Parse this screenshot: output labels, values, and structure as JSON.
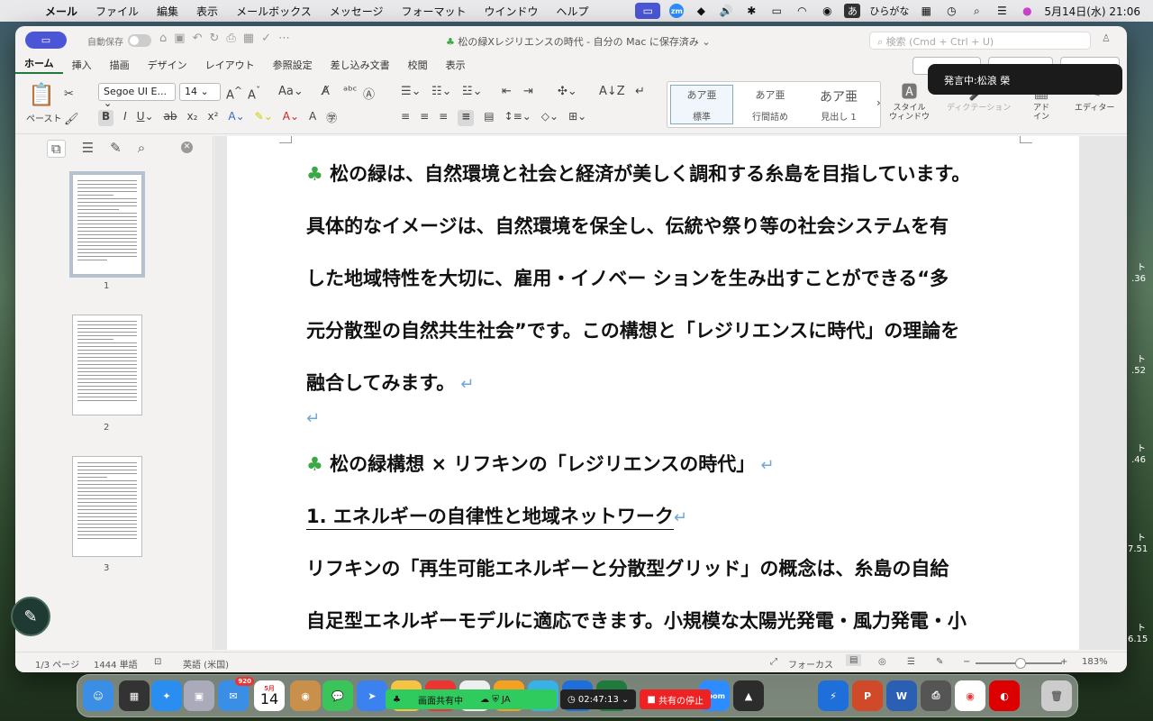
{
  "menubar": {
    "apple": "",
    "app": "メール",
    "items": [
      "ファイル",
      "編集",
      "表示",
      "メールボックス",
      "メッセージ",
      "フォーマット",
      "ウインドウ",
      "ヘルプ"
    ],
    "ime": "あ",
    "ime_label": "ひらがな",
    "clock": "5月14日(水)  21:06",
    "zoom_label": "zm"
  },
  "window": {
    "autosave": "自動保存",
    "title": "松の緑Xレジリエンスの時代 - 自分の Mac に保存済み",
    "search_placeholder": "検索 (Cmd + Ctrl + U)"
  },
  "tabs": [
    "ホーム",
    "挿入",
    "描画",
    "デザイン",
    "レイアウト",
    "参照設定",
    "差し込み文書",
    "校閲",
    "表示"
  ],
  "ribbon": {
    "paste": "ペースト",
    "font": "Segoe UI E...",
    "size": "14",
    "styles": [
      {
        "sample": "あア亜",
        "name": "標準"
      },
      {
        "sample": "あア亜",
        "name": "行間詰め"
      },
      {
        "sample": "あア亜",
        "name": "見出し 1"
      }
    ],
    "style_pane": "スタイル\nウィンドウ",
    "dictation": "ディクテーション",
    "addins": "アド\nイン",
    "editor": "エディター"
  },
  "toast": {
    "text": "発言中:松浪 榮"
  },
  "nav": {
    "pages": [
      "1",
      "2",
      "3"
    ]
  },
  "document": {
    "para1": [
      "松の緑は、自然環境と社会と経済が美しく調和する糸島を目指しています。",
      "具体的なイメージは、自然環境を保全し、伝統や祭り等の社会システムを有",
      "した地域特性を大切に、雇用・イノベー ションを生み出すことができる“多",
      "元分散型の自然共生社会”です。この構想と「レジリエンスに時代」の理論を",
      "融合してみます。"
    ],
    "heading": "松の緑構想 × リフキンの「レジリエンスの時代」",
    "section1": "1. エネルギーの自律性と地域ネットワーク",
    "para2": [
      "リフキンの「再生可能エネルギーと分散型グリッド」の概念は、糸島の自給",
      "自足型エネルギーモデルに適応できます。小規模な太陽光発電・風力発電・小"
    ]
  },
  "status": {
    "page": "1/3 ページ",
    "words": "1444 単語",
    "lang": "英語 (米国)",
    "focus": "フォーカス",
    "zoom": "183%"
  },
  "sidebar_numbers": [
    ".36",
    ".52",
    ".46",
    "7.51",
    "6.15"
  ],
  "sidebar_numbers_prefix": [
    "ト",
    "ト",
    "ト",
    "ト",
    "ト"
  ],
  "dock": {
    "mail_badge": "920",
    "calendar_month": "5月",
    "calendar_day": "14",
    "share_label": "画面共有中",
    "share_lang": "JA",
    "timer": "02:47:13",
    "stop": "共有の停止",
    "zoom_app": "zoom"
  }
}
